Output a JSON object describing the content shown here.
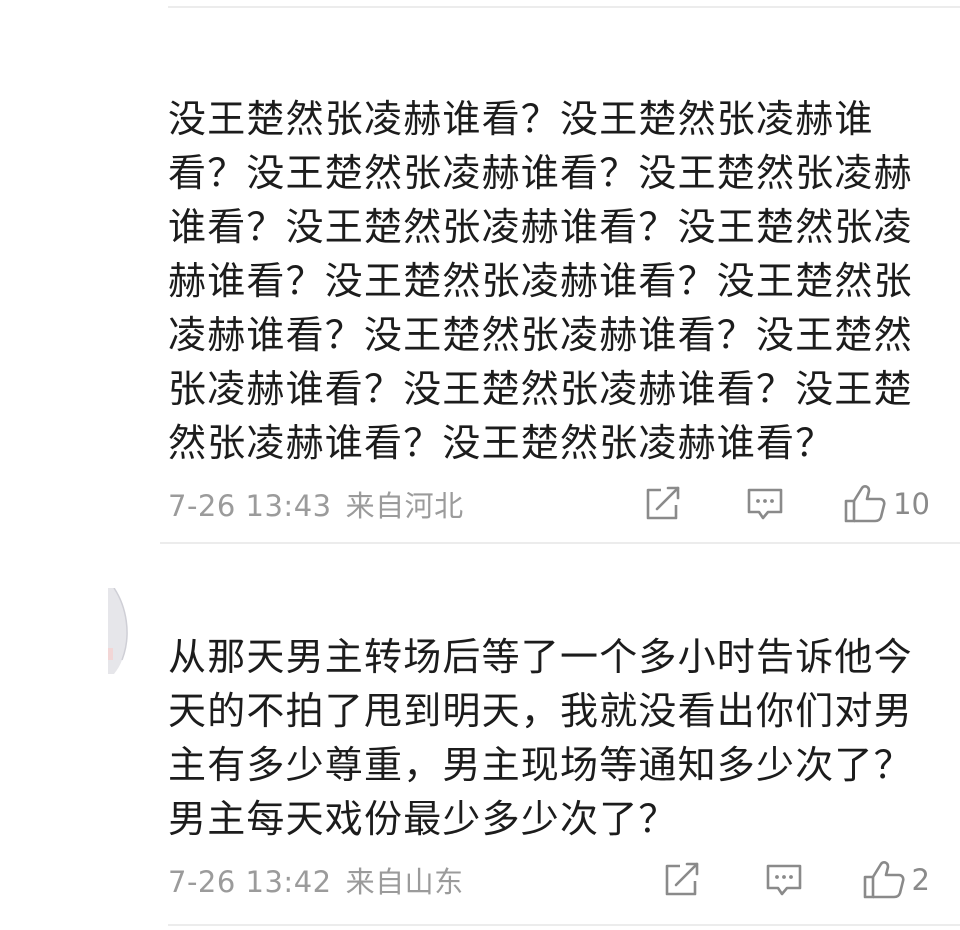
{
  "comments": [
    {
      "text": "没王楚然张凌赫谁看？没王楚然张凌赫谁看？没王楚然张凌赫谁看？没王楚然张凌赫谁看？没王楚然张凌赫谁看？没王楚然张凌赫谁看？没王楚然张凌赫谁看？没王楚然张凌赫谁看？没王楚然张凌赫谁看？没王楚然张凌赫谁看？没王楚然张凌赫谁看？没王楚然张凌赫谁看？没王楚然张凌赫谁看？",
      "time": "7-26 13:43",
      "location": "来自河北",
      "likes": "10"
    },
    {
      "text": "从那天男主转场后等了一个多小时告诉他今天的不拍了甩到明天，我就没看出你们对男主有多少尊重，男主现场等通知多少次了？男主每天戏份最少多少次了？",
      "time": "7-26 13:42",
      "location": "来自山东",
      "likes": "2"
    }
  ],
  "icons": {
    "share": "share-icon",
    "reply": "comment-icon",
    "like": "thumbs-up-icon"
  },
  "colors": {
    "text": "#1c1c1c",
    "meta": "#9b9b9b",
    "icon": "#8a8a8a",
    "divider": "#ececec"
  }
}
